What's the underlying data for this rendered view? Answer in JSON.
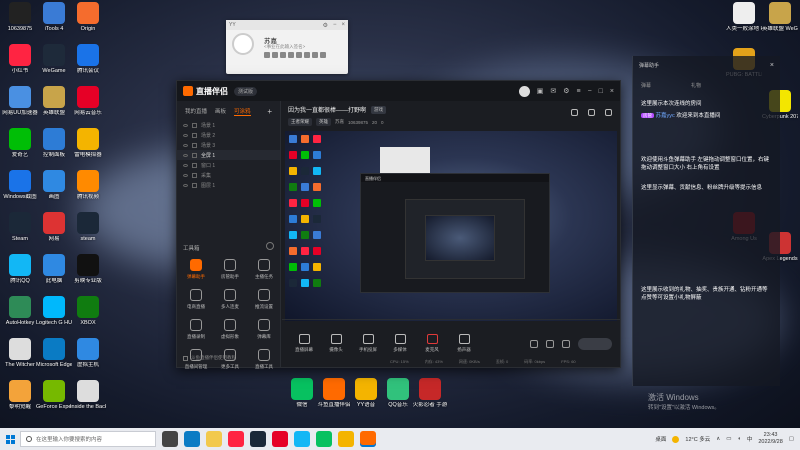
{
  "desktop": {
    "left_icons": [
      {
        "label": "10639875",
        "color": "#222"
      },
      {
        "label": "iTools 4",
        "color": "#3a7bd5"
      },
      {
        "label": "Origin",
        "color": "#f56c2d"
      },
      {
        "label": "小红书",
        "color": "#ff2442"
      },
      {
        "label": "WeGame",
        "color": "#1e2a3a"
      },
      {
        "label": "腾讯会议",
        "color": "#1a73e8"
      },
      {
        "label": "网易UU加速器",
        "color": "#4a90e2"
      },
      {
        "label": "英雄联盟",
        "color": "#c8a44a"
      },
      {
        "label": "网易云音乐",
        "color": "#e60026"
      },
      {
        "label": "爱奇艺",
        "color": "#00be06"
      },
      {
        "label": "控制面板",
        "color": "#2d7cd6"
      },
      {
        "label": "雷电模拟器",
        "color": "#f4b400"
      },
      {
        "label": "Windows截图",
        "color": "#1a73e8"
      },
      {
        "label": "画图",
        "color": "#2f89e2"
      },
      {
        "label": "腾讯视频",
        "color": "#ff8a00"
      },
      {
        "label": "Steam",
        "color": "#1b2838"
      },
      {
        "label": "网易",
        "color": "#d33"
      },
      {
        "label": "steam",
        "color": "#1b2838"
      },
      {
        "label": "腾讯QQ",
        "color": "#12b7f5"
      },
      {
        "label": "此电脑",
        "color": "#2f89e2"
      },
      {
        "label": "剪映专业版",
        "color": "#111"
      },
      {
        "label": "AutoHotkey",
        "color": "#2e8b57"
      },
      {
        "label": "Logitech G HUB",
        "color": "#00b8fc"
      },
      {
        "label": "XBOX",
        "color": "#107c10"
      },
      {
        "label": "The Witcher",
        "color": "#ddd"
      },
      {
        "label": "Microsoft Edge",
        "color": "#0a7bc4"
      },
      {
        "label": "虚拟主机",
        "color": "#2f89e2"
      },
      {
        "label": "黎明觉醒",
        "color": "#f3a33a"
      },
      {
        "label": "GeForce Experience",
        "color": "#76b900"
      },
      {
        "label": "Inside the Backroom",
        "color": "#ddd"
      }
    ],
    "right_icons": [
      {
        "label": "人类一败涂地 Human Fa...",
        "color": "#eee"
      },
      {
        "label": "英雄联盟 WeGame版",
        "color": "#c8a44a"
      },
      {
        "label": "PUBG: BATTLEGR...",
        "color": "#e3a21a"
      },
      {
        "label": "Apex Legends",
        "color": "#cd3333"
      },
      {
        "label": "Among Us",
        "color": "#c51111"
      },
      {
        "label": "Cyberpunk 2077",
        "color": "#f3e600"
      }
    ],
    "bottom_icons": [
      {
        "label": "微信",
        "color": "#07c160"
      },
      {
        "label": "斗鱼直播伴侣",
        "color": "#ff6a00"
      },
      {
        "label": "YY语音",
        "color": "#f4b400"
      },
      {
        "label": "QQ音乐",
        "color": "#31c27c"
      },
      {
        "label": "火影忍者 手游",
        "color": "#c62828"
      }
    ]
  },
  "profile_card": {
    "header": "YY",
    "name": "苏嘉",
    "signature": "<事业在此输入签名>"
  },
  "app": {
    "title": "直播伴侣",
    "version": "测试版",
    "sidebar": {
      "tabs": [
        "我的直播",
        "画板",
        "可涂鸦"
      ],
      "scenes": [
        "场景 1",
        "场景 2",
        "场景 3",
        "全屏 1",
        "窗口 1",
        "采集",
        "图层 1"
      ],
      "tools_title": "工具箱",
      "tools": [
        "弹幕助手",
        "房管助手",
        "主播任务",
        "电商直播",
        "多人连麦",
        "推流设置",
        "直播录制",
        "虚拟形象",
        "弹幕库",
        "直播间管理",
        "更多工具",
        "直播工具"
      ],
      "footer": "斗鱼直播伴侣使用教程"
    },
    "room": {
      "title": "因为我一直都很棒——打野啊",
      "category": "游戏",
      "meta": [
        "王者荣耀",
        "英雄",
        "苏嘉",
        "10639875",
        "20",
        "0"
      ]
    },
    "bottom_buttons": [
      "直播屏幕",
      "摄像头",
      "手机投屏",
      "多媒体",
      "麦克风",
      "扬声器"
    ],
    "status": [
      "CPU: 15%",
      "内存: 43%",
      "网速: 0KB/s",
      "丢帧: 0",
      "码率: 0kbps",
      "FPS: 60"
    ]
  },
  "chat": {
    "header": "弹幕助手",
    "sub_left": "弹幕",
    "sub_right": "礼物",
    "lines": [
      {
        "user": "",
        "text": "这里展示本次连线的房间"
      },
      {
        "tag": "房管",
        "user": "苏嘉yyc",
        "text": "欢迎来到本直播间"
      },
      {
        "user": "",
        "text": "欢迎使用斗鱼弹幕助手 左键拖动调整窗口位置，右键拖动调整窗口大小 右上角有设置"
      },
      {
        "user": "",
        "text": "这里显示弹幕、贡献信息、粉丝牌升级等提示信息"
      },
      {
        "user": "",
        "text": "这里展示收到的礼物、抽奖、贵族开通、钻粉开通等 点赞等可设置小礼物屏蔽"
      }
    ]
  },
  "watermark": {
    "line1": "激活 Windows",
    "line2": "转到\"设置\"以激活 Windows。"
  },
  "taskbar": {
    "search_placeholder": "在这里输入你要搜索的内容",
    "weather": "12°C 多云",
    "ime": "中",
    "time": "23:43",
    "date": "2022/9/28",
    "desktop_label": "桌面"
  },
  "colors": {
    "accent": "#ff6a00",
    "taskbar": "#e9ebf0",
    "app_bg": "#1b1d22"
  }
}
